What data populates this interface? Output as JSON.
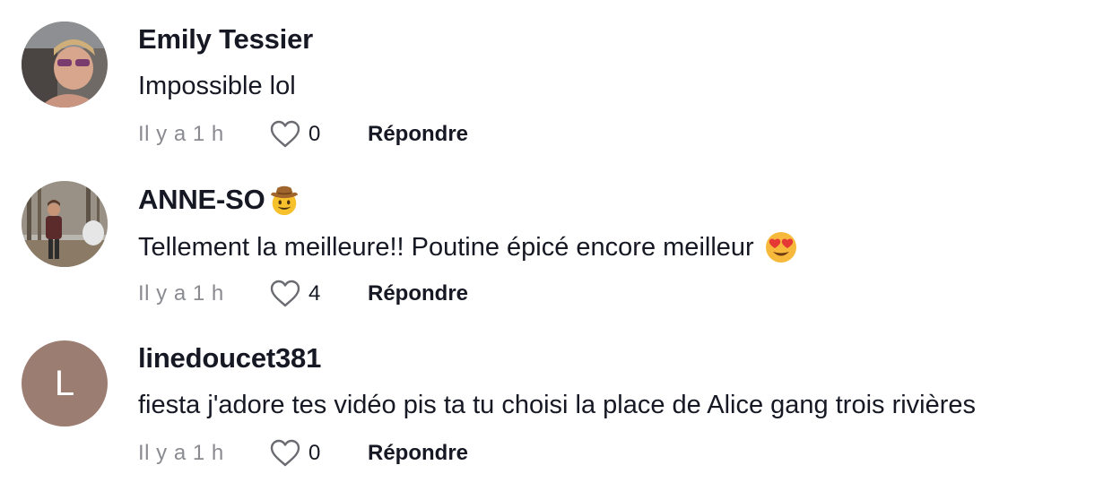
{
  "comments": [
    {
      "username": "Emily Tessier",
      "username_emoji": "",
      "text": "Impossible lol",
      "text_emoji": "",
      "time": "Il y a 1 h",
      "likes": "0",
      "reply_label": "Répondre",
      "avatar_icon": "photo-avatar"
    },
    {
      "username": "ANNE-SO",
      "username_emoji": "cowboy-hat-face-emoji",
      "text": "Tellement la meilleure!! Poutine épicé encore meilleur",
      "text_emoji": "heart-eyes-emoji",
      "time": "Il y a 1 h",
      "likes": "4",
      "reply_label": "Répondre",
      "avatar_icon": "photo-avatar"
    },
    {
      "username": "linedoucet381",
      "username_emoji": "",
      "text": "fiesta j'adore tes vidéo pis ta tu choisi la place de Alice gang trois rivières",
      "text_emoji": "",
      "time": "Il y a 1 h",
      "likes": "0",
      "reply_label": "Répondre",
      "avatar_letter": "L",
      "avatar_color": "#9c7d72"
    }
  ],
  "colors": {
    "primary_text": "#161823",
    "secondary_text": "#8a8b91",
    "heart_outline": "#161823"
  }
}
